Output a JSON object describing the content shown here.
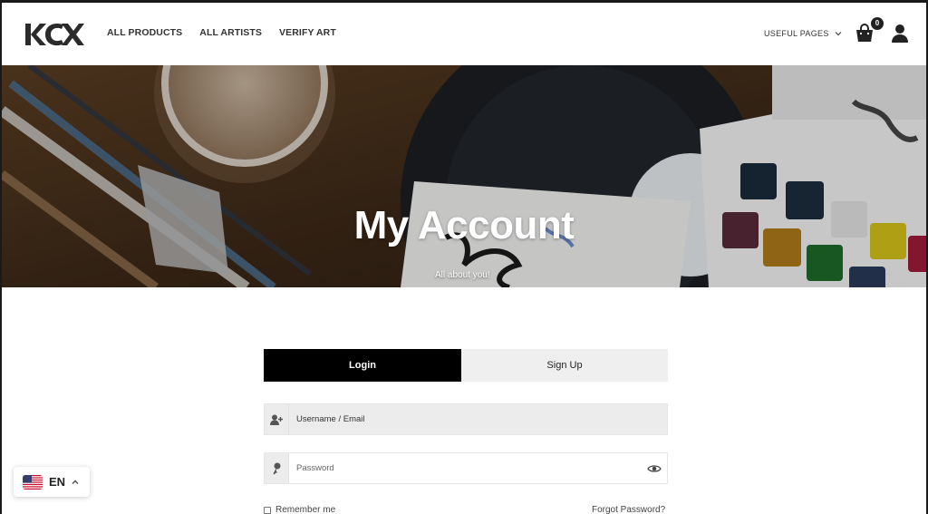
{
  "brand": {
    "logo_text": "KCX"
  },
  "nav": {
    "items": [
      {
        "label": "ALL PRODUCTS"
      },
      {
        "label": "ALL ARTISTS"
      },
      {
        "label": "VERIFY ART"
      }
    ],
    "useful_pages": "USEFUL PAGES",
    "cart_count": "0"
  },
  "hero": {
    "title": "My Account",
    "subtitle": "All about you!"
  },
  "form": {
    "tabs": [
      {
        "label": "Login",
        "active": true
      },
      {
        "label": "Sign Up",
        "active": false
      }
    ],
    "username_placeholder": "Username / Email",
    "password_placeholder": "Password",
    "remember_label": "Remember me",
    "forgot_label": "Forgot Password?"
  },
  "language": {
    "code": "EN"
  },
  "icons": {
    "user_plus": "user-plus-icon",
    "key": "key-icon",
    "eye": "eye-icon",
    "cart": "shopping-bag-icon",
    "account": "user-icon",
    "flag": "us-flag-icon"
  },
  "colors": {
    "active_tab": "#000000",
    "inactive_tab": "#efefef",
    "field_bg": "#ececec"
  }
}
